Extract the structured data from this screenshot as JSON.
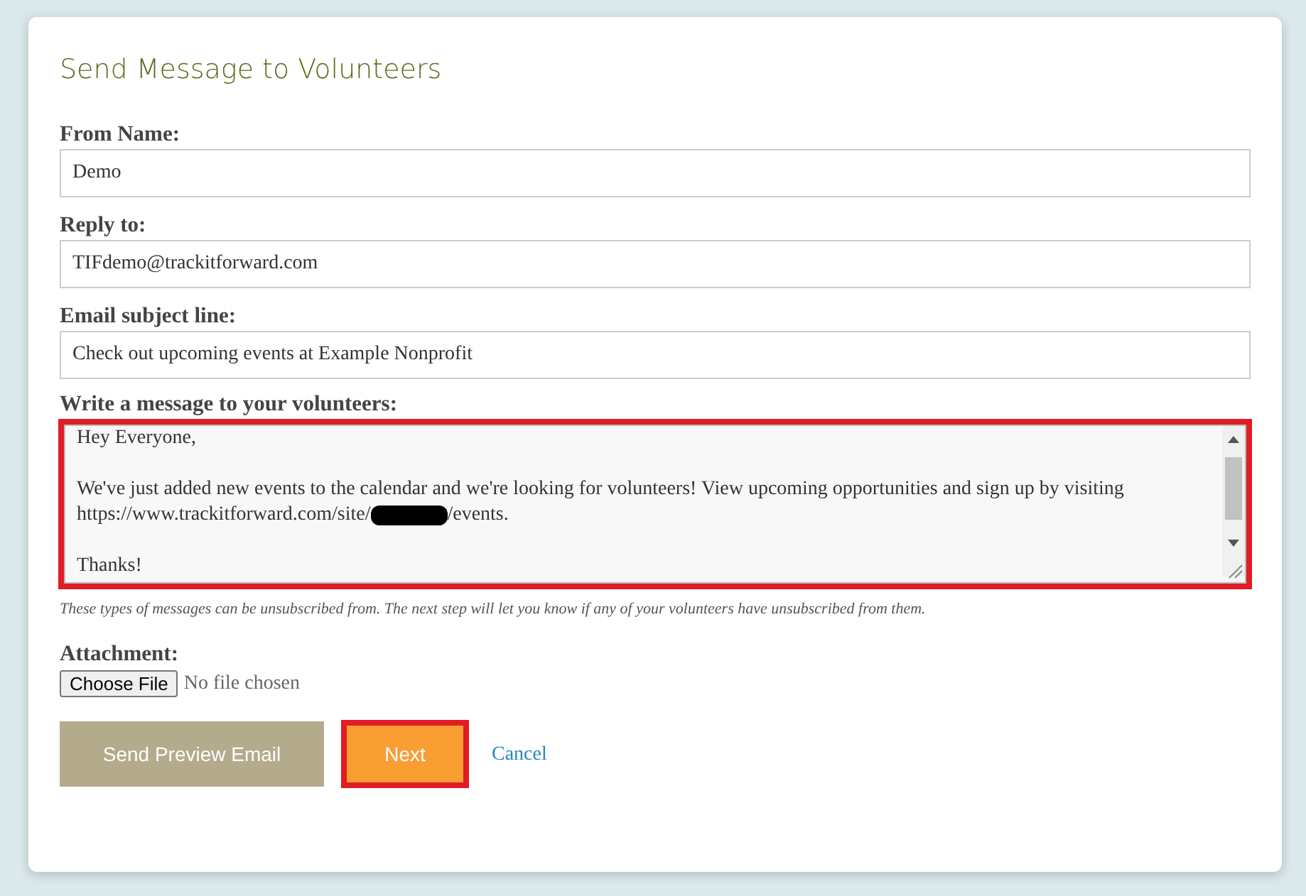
{
  "title": "Send Message to Volunteers",
  "fields": [
    {
      "label": "From Name:",
      "value": "Demo"
    },
    {
      "label": "Reply to:",
      "value": "TIFdemo@trackitforward.com"
    },
    {
      "label": "Email subject line:",
      "value": "Check out upcoming events at Example Nonprofit"
    }
  ],
  "message": {
    "label": "Write a message to your volunteers:",
    "highlighted": true,
    "lines": [
      {
        "kind": "line",
        "parts": [
          {
            "kind": "text",
            "text": "Hey Everyone,"
          }
        ]
      },
      {
        "kind": "blank"
      },
      {
        "kind": "line",
        "parts": [
          {
            "kind": "text",
            "text": "We've just added new events to the calendar and we're looking for volunteers! View upcoming opportunities and sign up by visiting"
          }
        ]
      },
      {
        "kind": "line",
        "parts": [
          {
            "kind": "text",
            "text": "https://www.trackitforward.com/site/"
          },
          {
            "kind": "redacted"
          },
          {
            "kind": "text",
            "text": "/events."
          }
        ]
      },
      {
        "kind": "blank"
      },
      {
        "kind": "line",
        "parts": [
          {
            "kind": "text",
            "text": "Thanks!"
          }
        ]
      }
    ],
    "note": "These types of messages can be unsubscribed from. The next step will let you know if any of your volunteers have unsubscribed from them."
  },
  "attachment": {
    "label": "Attachment:",
    "button": "Choose File",
    "status": "No file chosen"
  },
  "buttons": [
    {
      "kind": "secondary",
      "label": "Send Preview Email",
      "highlighted": false
    },
    {
      "kind": "primary",
      "label": "Next",
      "highlighted": true
    },
    {
      "kind": "link",
      "label": "Cancel",
      "highlighted": false
    }
  ]
}
